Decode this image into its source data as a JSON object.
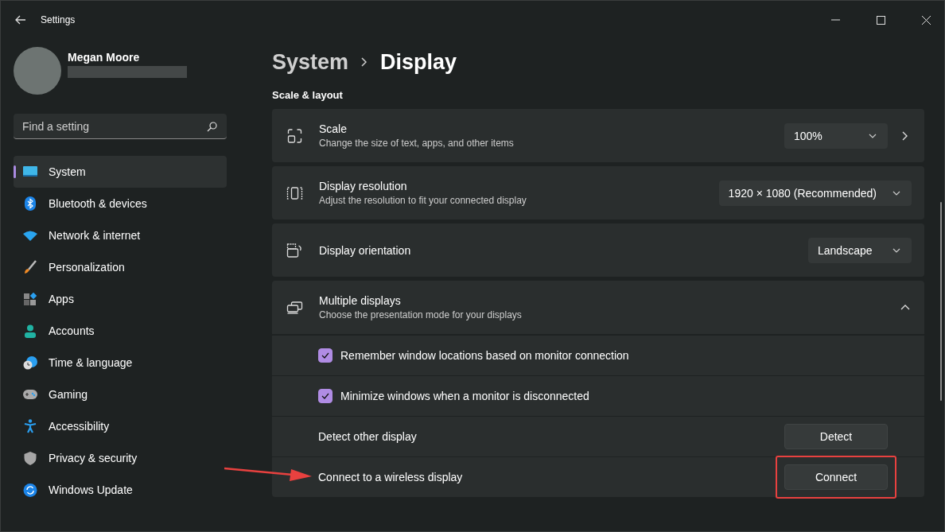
{
  "window": {
    "title": "Settings"
  },
  "profile": {
    "name": "Megan Moore"
  },
  "search": {
    "placeholder": "Find a setting"
  },
  "nav": [
    {
      "label": "System",
      "selected": true
    },
    {
      "label": "Bluetooth & devices",
      "selected": false
    },
    {
      "label": "Network & internet",
      "selected": false
    },
    {
      "label": "Personalization",
      "selected": false
    },
    {
      "label": "Apps",
      "selected": false
    },
    {
      "label": "Accounts",
      "selected": false
    },
    {
      "label": "Time & language",
      "selected": false
    },
    {
      "label": "Gaming",
      "selected": false
    },
    {
      "label": "Accessibility",
      "selected": false
    },
    {
      "label": "Privacy & security",
      "selected": false
    },
    {
      "label": "Windows Update",
      "selected": false
    }
  ],
  "breadcrumb": {
    "parent": "System",
    "current": "Display"
  },
  "section_title": "Scale & layout",
  "cards": [
    {
      "kind": "setting",
      "title": "Scale",
      "subtitle": "Change the size of text, apps, and other items",
      "dropdown": "100%",
      "chevron": true
    },
    {
      "kind": "setting",
      "title": "Display resolution",
      "subtitle": "Adjust the resolution to fit your connected display",
      "dropdown": "1920 × 1080 (Recommended)"
    },
    {
      "kind": "setting",
      "title": "Display orientation",
      "dropdown": "Landscape"
    },
    {
      "kind": "expander",
      "title": "Multiple displays",
      "subtitle": "Choose the presentation mode for your displays",
      "expanded": true,
      "children": [
        {
          "kind": "checkbox",
          "label": "Remember window locations based on monitor connection",
          "checked": true
        },
        {
          "kind": "checkbox",
          "label": "Minimize windows when a monitor is disconnected",
          "checked": true
        },
        {
          "kind": "button",
          "label": "Detect other display",
          "button": "Detect"
        },
        {
          "kind": "button",
          "label": "Connect to a wireless display",
          "button": "Connect",
          "highlighted": true
        }
      ]
    }
  ]
}
